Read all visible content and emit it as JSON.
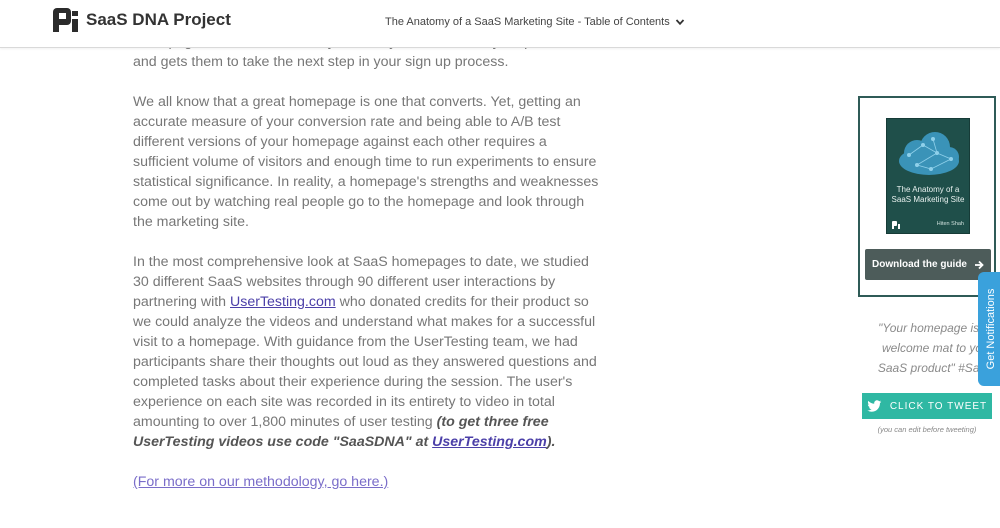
{
  "header": {
    "site_title": "SaaS DNA Project",
    "toc_label": "The Anatomy of a SaaS Marketing Site - Table of Contents"
  },
  "article": {
    "p1": "homepage introduces users to your site, your brand, and your product—and gets them to take the next step in your sign up process.",
    "p2": "We all know that a great homepage is one that converts. Yet, getting an accurate measure of your conversion rate and being able to A/B test different versions of your homepage against each other requires a sufficient volume of visitors and enough time to run experiments to ensure statistical significance. In reality, a homepage's strengths and weaknesses come out by watching real people go to the homepage and look through the marketing site.",
    "p3_a": "In the most comprehensive look at SaaS homepages to date, we studied 30 different SaaS websites through 90 different user interactions by partnering with ",
    "p3_link": "UserTesting.com",
    "p3_b": " who donated credits for their product so we could analyze the videos and understand what makes for a successful visit to a homepage. With guidance from the UserTesting team, we had participants share their thoughts out loud as they answered questions and completed tasks about their experience during the session. The user's experience on each site was recorded in its entirety to video in total amounting to over 1,800 minutes of user testing ",
    "p3_bold_a": "(to get three free UserTesting videos use code \"SaaSDNA\" at ",
    "p3_bold_link": "UserTesting.com",
    "p3_bold_b": ").",
    "methodology_link": "(For more on our methodology, go here.)"
  },
  "sidebar": {
    "book_title": "The Anatomy of a SaaS Marketing Site",
    "book_author": "Hiten Shah",
    "download_label": "Download the guide",
    "quote_lines": [
      "\"Your homepage is t",
      "welcome mat to yo",
      "SaaS product\" #Saa"
    ],
    "tweet_label": "CLICK TO TWEET",
    "tweet_note": "(you can edit before tweeting)"
  },
  "notifications": {
    "label": "Get Notifications"
  },
  "colors": {
    "accent": "#2fb8a3",
    "book": "#1f4f4a",
    "notif": "#3aa1dc",
    "link": "#4b3fa8"
  }
}
